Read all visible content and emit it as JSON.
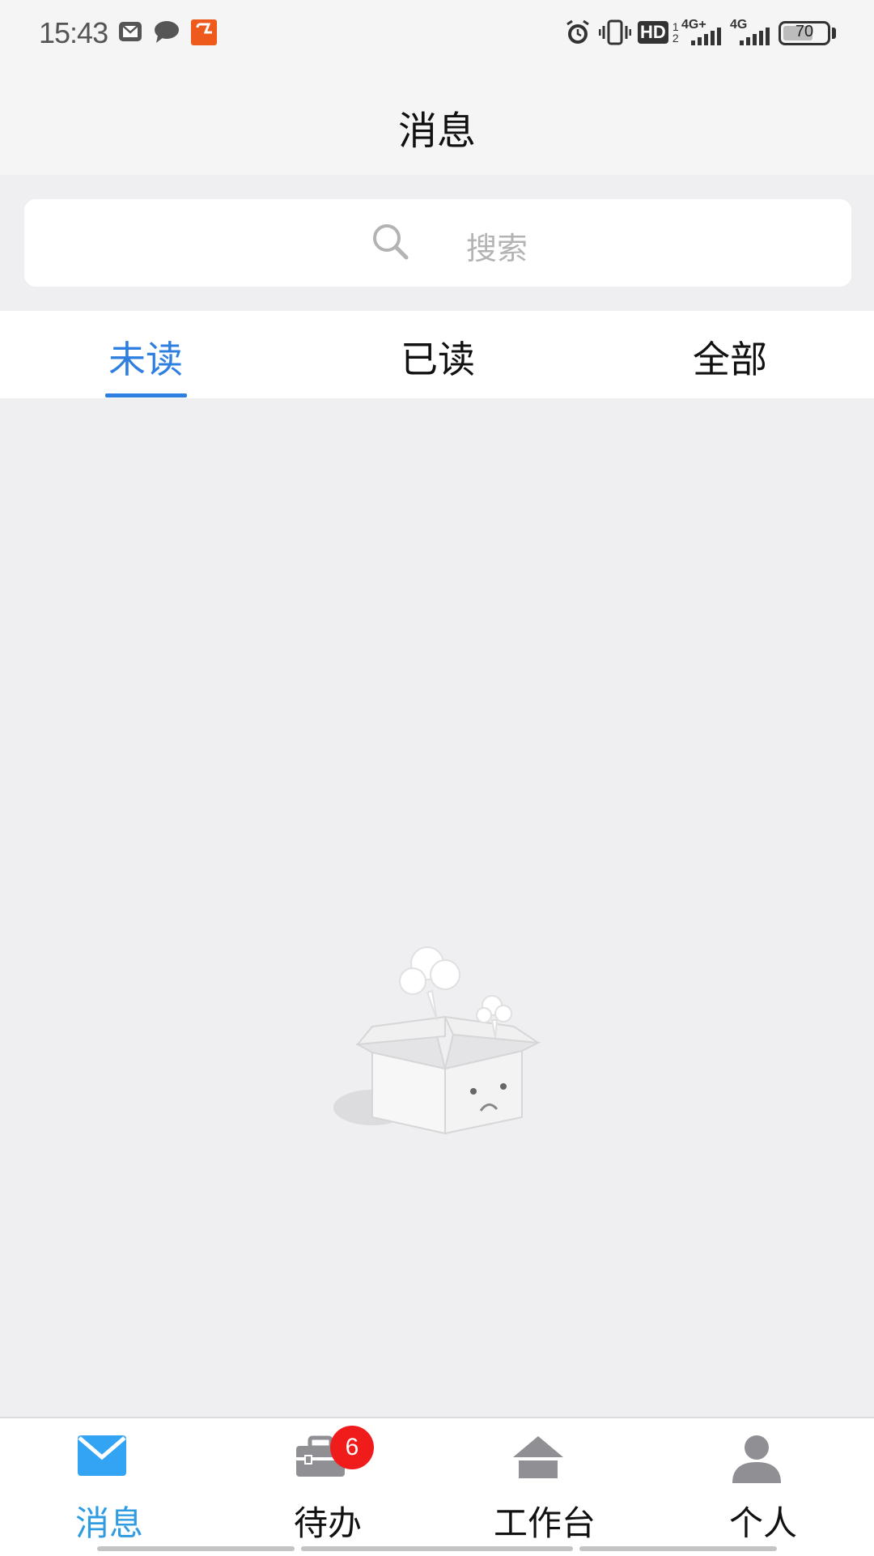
{
  "status_bar": {
    "time": "15:43",
    "battery": "70",
    "battery_fraction": 0.7,
    "network_labels": [
      "4G+",
      "4G"
    ],
    "hd_label": "HD",
    "icons": [
      "mail-icon",
      "chat-icon",
      "app-notification-icon",
      "alarm-icon",
      "vibrate-icon",
      "hd-voice-icon",
      "signal-icon",
      "signal-icon",
      "battery-icon"
    ]
  },
  "header": {
    "title": "消息"
  },
  "search": {
    "placeholder": "搜索"
  },
  "tabs": [
    {
      "label": "未读",
      "active": true
    },
    {
      "label": "已读",
      "active": false
    },
    {
      "label": "全部",
      "active": false
    }
  ],
  "bottom_nav": {
    "items": [
      {
        "label": "消息",
        "icon": "mail-icon",
        "active": true
      },
      {
        "label": "待办",
        "icon": "briefcase-icon",
        "active": false
      },
      {
        "label": "工作台",
        "icon": "home-icon",
        "active": false
      },
      {
        "label": "个人",
        "icon": "person-icon",
        "active": false
      }
    ],
    "badge": "6"
  },
  "colors": {
    "accent": "#2f7fe0",
    "nav_active": "#2f9be0",
    "badge": "#f01c1c",
    "background": "#efeff1"
  }
}
